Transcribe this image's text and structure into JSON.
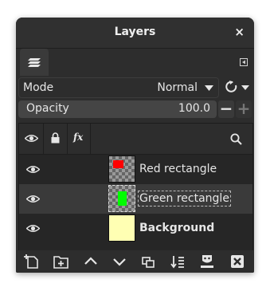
{
  "dialog": {
    "title": "Layers",
    "close_glyph": "×"
  },
  "tabs": [
    {
      "icon": "layers-icon",
      "active": true
    }
  ],
  "mode": {
    "label": "Mode",
    "value": "Normal"
  },
  "opacity": {
    "label": "Opacity",
    "value": "100.0",
    "minus": "−",
    "plus": "+"
  },
  "header": {
    "fx_label": "fx"
  },
  "layers": [
    {
      "name": "Red rectangle",
      "visible": true,
      "thumb": "red-on-transparent",
      "selected": false
    },
    {
      "name": "Green rectangle",
      "visible": true,
      "thumb": "green-on-transparent",
      "selected": true
    },
    {
      "name": "Background",
      "visible": true,
      "thumb": "light-yellow-fill",
      "selected": false
    }
  ],
  "colors": {
    "red": "#ff0000",
    "green": "#00ff00",
    "background_fill": "#ffffb3",
    "panel": "#2d2d2d"
  },
  "bottom_toolbar": [
    "new-layer-icon",
    "new-layer-group-icon",
    "raise-layer-icon",
    "lower-layer-icon",
    "duplicate-layer-icon",
    "merge-down-icon",
    "add-mask-icon",
    "delete-layer-icon"
  ]
}
